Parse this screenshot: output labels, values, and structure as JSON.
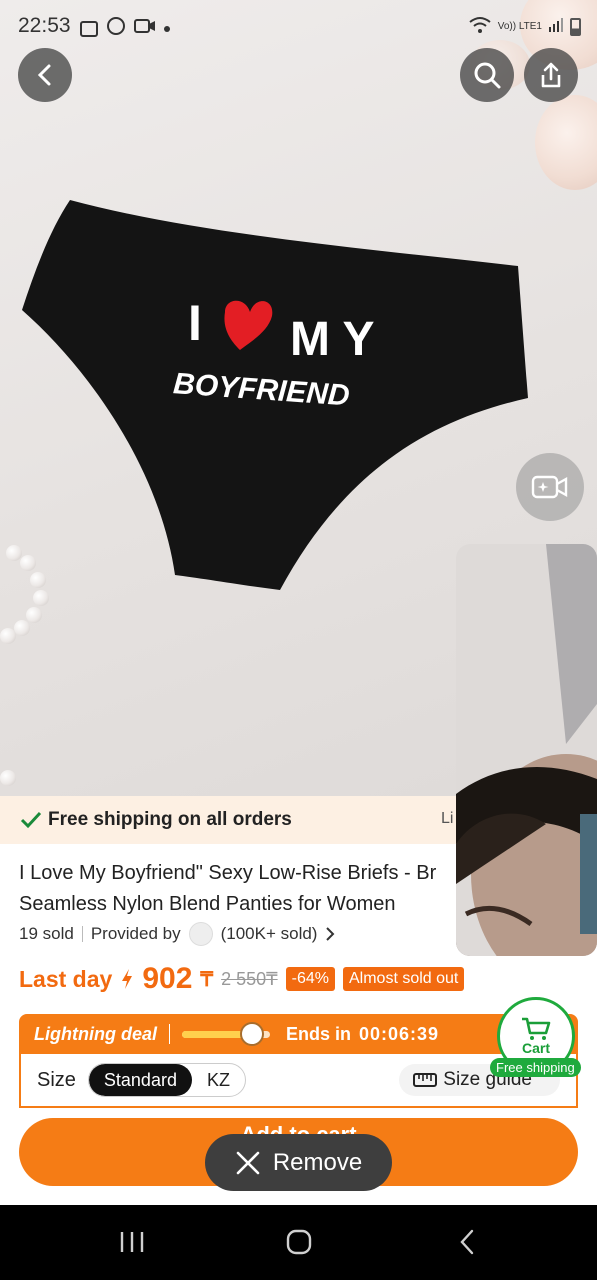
{
  "status_bar": {
    "time": "22:53",
    "network_label": "Vo)) LTE1"
  },
  "product_image": {
    "print_text_line1_left": "I",
    "print_text_line1_right": "M Y",
    "print_text_line2": "BOYFRIEND"
  },
  "shipping_banner": {
    "text": "Free shipping on all orders",
    "cut_text": "Li"
  },
  "product": {
    "title_line1": "I Love My Boyfriend\" Sexy Low-Rise Briefs - Br",
    "title_line2": "Seamless Nylon Blend Panties for Women",
    "sold": "19 sold",
    "provided_by": "Provided by",
    "store_sold": "(100K+ sold)"
  },
  "price": {
    "last_day": "Last day",
    "current": "902",
    "currency": "₸",
    "original": "2 550₸",
    "discount": "-64%",
    "status_badge": "Almost sold out"
  },
  "deal": {
    "label": "Lightning deal",
    "progress": 0.75,
    "ends_label": "Ends in",
    "timer": "00:06:39"
  },
  "size": {
    "label": "Size",
    "options": [
      "Standard",
      "KZ"
    ],
    "selected": "Standard",
    "guide_label": "Size guide"
  },
  "cart": {
    "label": "Cart",
    "free_shipping": "Free shipping"
  },
  "bottom": {
    "add_to_cart": "Add to cart",
    "remove": "Remove"
  },
  "colors": {
    "accent": "#f57c15",
    "price": "#f26a10",
    "green": "#1faa3d"
  }
}
